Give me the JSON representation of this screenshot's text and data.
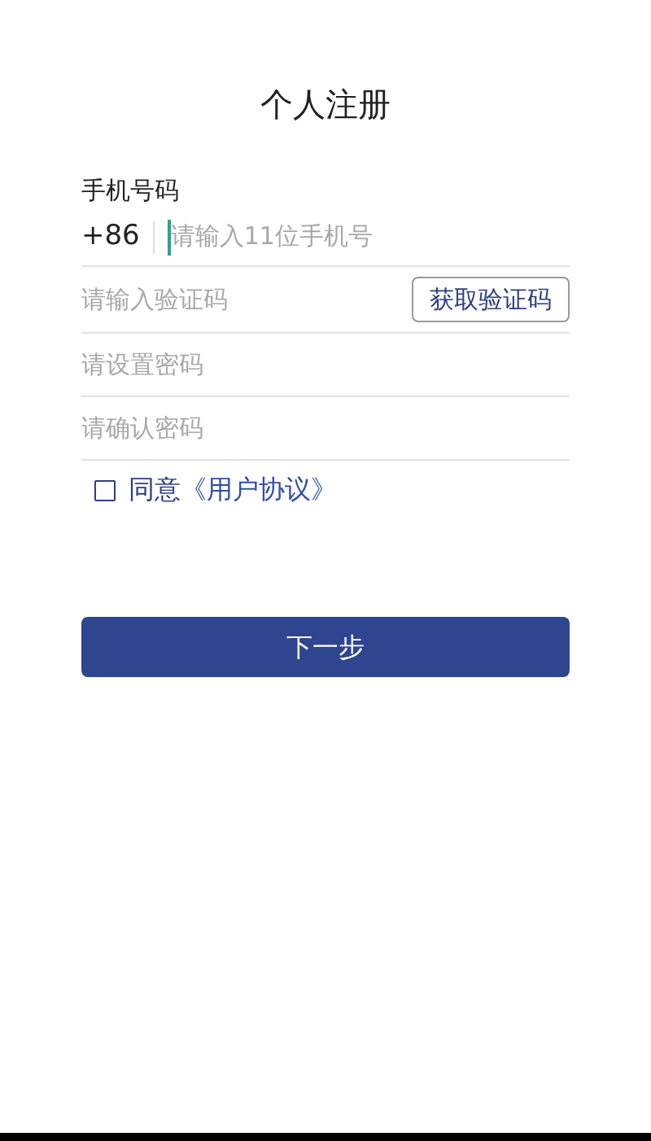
{
  "title": "个人注册",
  "phone": {
    "label": "手机号码",
    "prefix": "+86",
    "placeholder": "请输入11位手机号",
    "focused": true
  },
  "code": {
    "placeholder": "请输入验证码",
    "button": "获取验证码"
  },
  "password": {
    "placeholder": "请设置密码"
  },
  "confirm": {
    "placeholder": "请确认密码"
  },
  "agreement": {
    "checked": false,
    "text": "同意",
    "link": "《用户协议》"
  },
  "next_button": "下一步"
}
